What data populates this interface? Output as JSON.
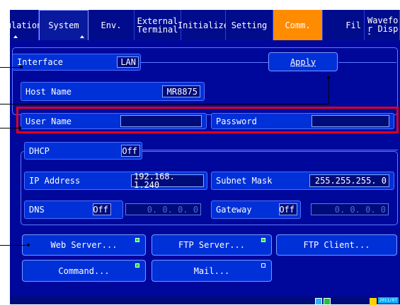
{
  "tabs": [
    {
      "label": "ulation",
      "style": "normal",
      "mark": "left"
    },
    {
      "label": "System",
      "style": "active",
      "mark": "right"
    },
    {
      "label": "Env.",
      "style": "normal",
      "mark": ""
    },
    {
      "label": "External Terminal",
      "style": "normal",
      "mark": ""
    },
    {
      "label": "Initialize",
      "style": "normal",
      "mark": ""
    },
    {
      "label": "Setting",
      "style": "normal",
      "mark": ""
    },
    {
      "label": "Comm.",
      "style": "orange",
      "mark": ""
    },
    {
      "label": "Fil",
      "style": "normal",
      "mark": ""
    },
    {
      "label": "Wavefor Displa",
      "style": "normal",
      "mark": ""
    }
  ],
  "interface": {
    "label": "Interface",
    "value": "LAN"
  },
  "apply_label": "Apply",
  "host": {
    "label": "Host Name",
    "value": "MR8875"
  },
  "user": {
    "label": "User Name",
    "value": ""
  },
  "password": {
    "label": "Password",
    "value": ""
  },
  "dhcp": {
    "label": "DHCP",
    "value": "Off"
  },
  "ip": {
    "label": "IP Address",
    "value": "192.168.  1.240"
  },
  "subnet": {
    "label": "Subnet Mask",
    "value": "255.255.255.  0"
  },
  "dns": {
    "label": "DNS",
    "toggle": "Off",
    "value": "0.  0.  0.  0"
  },
  "gateway": {
    "label": "Gateway",
    "toggle": "Off",
    "value": "0.  0.  0.  0"
  },
  "buttons": {
    "web_server": {
      "label": "Web Server...",
      "led": "on"
    },
    "ftp_server": {
      "label": "FTP Server...",
      "led": "on"
    },
    "ftp_client": {
      "label": "FTP Client..."
    },
    "command": {
      "label": "Command...",
      "led": "on"
    },
    "mail": {
      "label": "Mail...",
      "led": "off"
    }
  },
  "status_bar": {
    "date": "2011/07"
  },
  "colors": {
    "accent_orange": "#ff8c00",
    "highlight_red": "#e2001a",
    "led_green": "#20e040"
  }
}
